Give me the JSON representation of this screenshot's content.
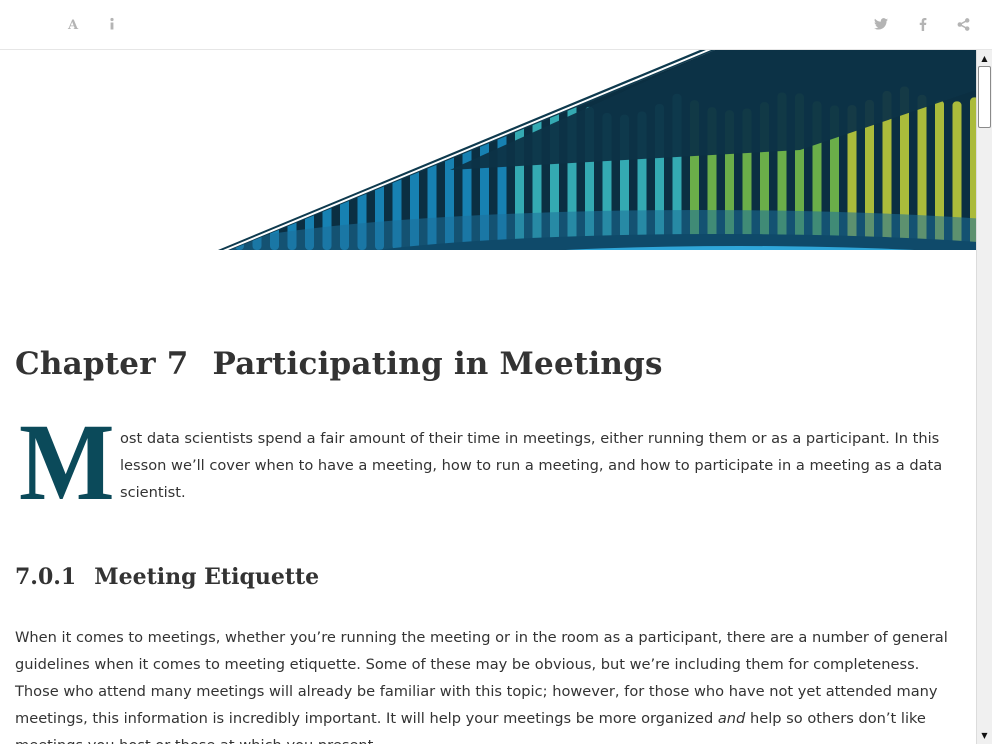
{
  "toolbar": {
    "icons_left": [
      "font-settings-icon",
      "info-icon"
    ],
    "icons_right": [
      "twitter-icon",
      "facebook-icon",
      "share-icon"
    ]
  },
  "banner": {
    "description_colors": [
      "#0e3a4e",
      "#1a8fc5",
      "#3cc0c5",
      "#7dc44a",
      "#c8d43a"
    ]
  },
  "chapter": {
    "number": "Chapter 7",
    "title": "Participating in Meetings"
  },
  "intro": {
    "dropcap": "M",
    "text": "ost data scientists spend a fair amount of their time in meetings, either running them or as a participant. In this lesson we’ll cover when to have a meeting, how to run a meeting, and how to participate in a meeting as a data scientist."
  },
  "section": {
    "number": "7.0.1",
    "title": "Meeting Etiquette"
  },
  "paragraph": {
    "before_em": "When it comes to meetings, whether you’re running the meeting or in the room as a participant, there are a number of general guidelines when it comes to meeting etiquette. Some of these may be obvious, but we’re including them for completeness. Those who attend many meetings will already be familiar with this topic; however, for those who have not yet attended many meetings, this information is incredibly important. It will help your meetings be more organized ",
    "em": "and",
    "after_em": " help so others don’t like meetings you host or those at which you present."
  },
  "scrollbar": {
    "up_arrow": "▲",
    "down_arrow": "▼"
  }
}
